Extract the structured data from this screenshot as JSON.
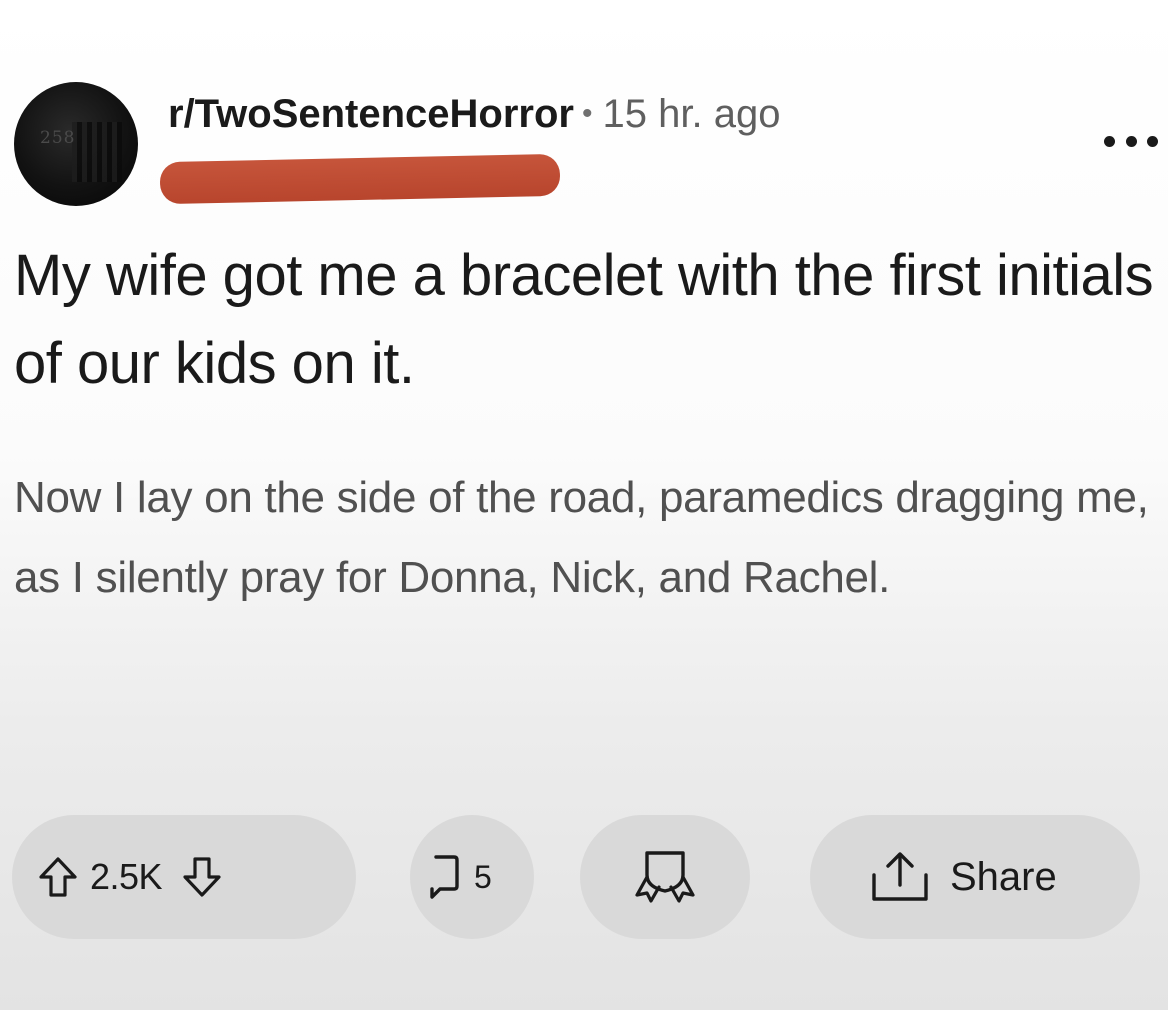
{
  "post": {
    "subreddit": "r/TwoSentenceHorror",
    "separator": "•",
    "time_ago": "15 hr. ago",
    "avatar_text": "258",
    "title": "My wife got me a bracelet with the first initials of our kids on it.",
    "body": "Now I lay on the side of the road, paramedics dragging me, as I silently pray for Donna, Nick, and Rachel."
  },
  "actions": {
    "vote_count": "2.5K",
    "comment_count": "5",
    "share_label": "Share"
  },
  "colors": {
    "redaction": "#b8452d",
    "pill_background": "#d9d9d9",
    "text": "#1a1a1a",
    "body_text": "#505050"
  },
  "icons": {
    "upvote": "arrow-up-icon",
    "downvote": "arrow-down-icon",
    "comment": "comment-icon",
    "award": "award-icon",
    "share": "share-icon",
    "more": "more-icon"
  }
}
